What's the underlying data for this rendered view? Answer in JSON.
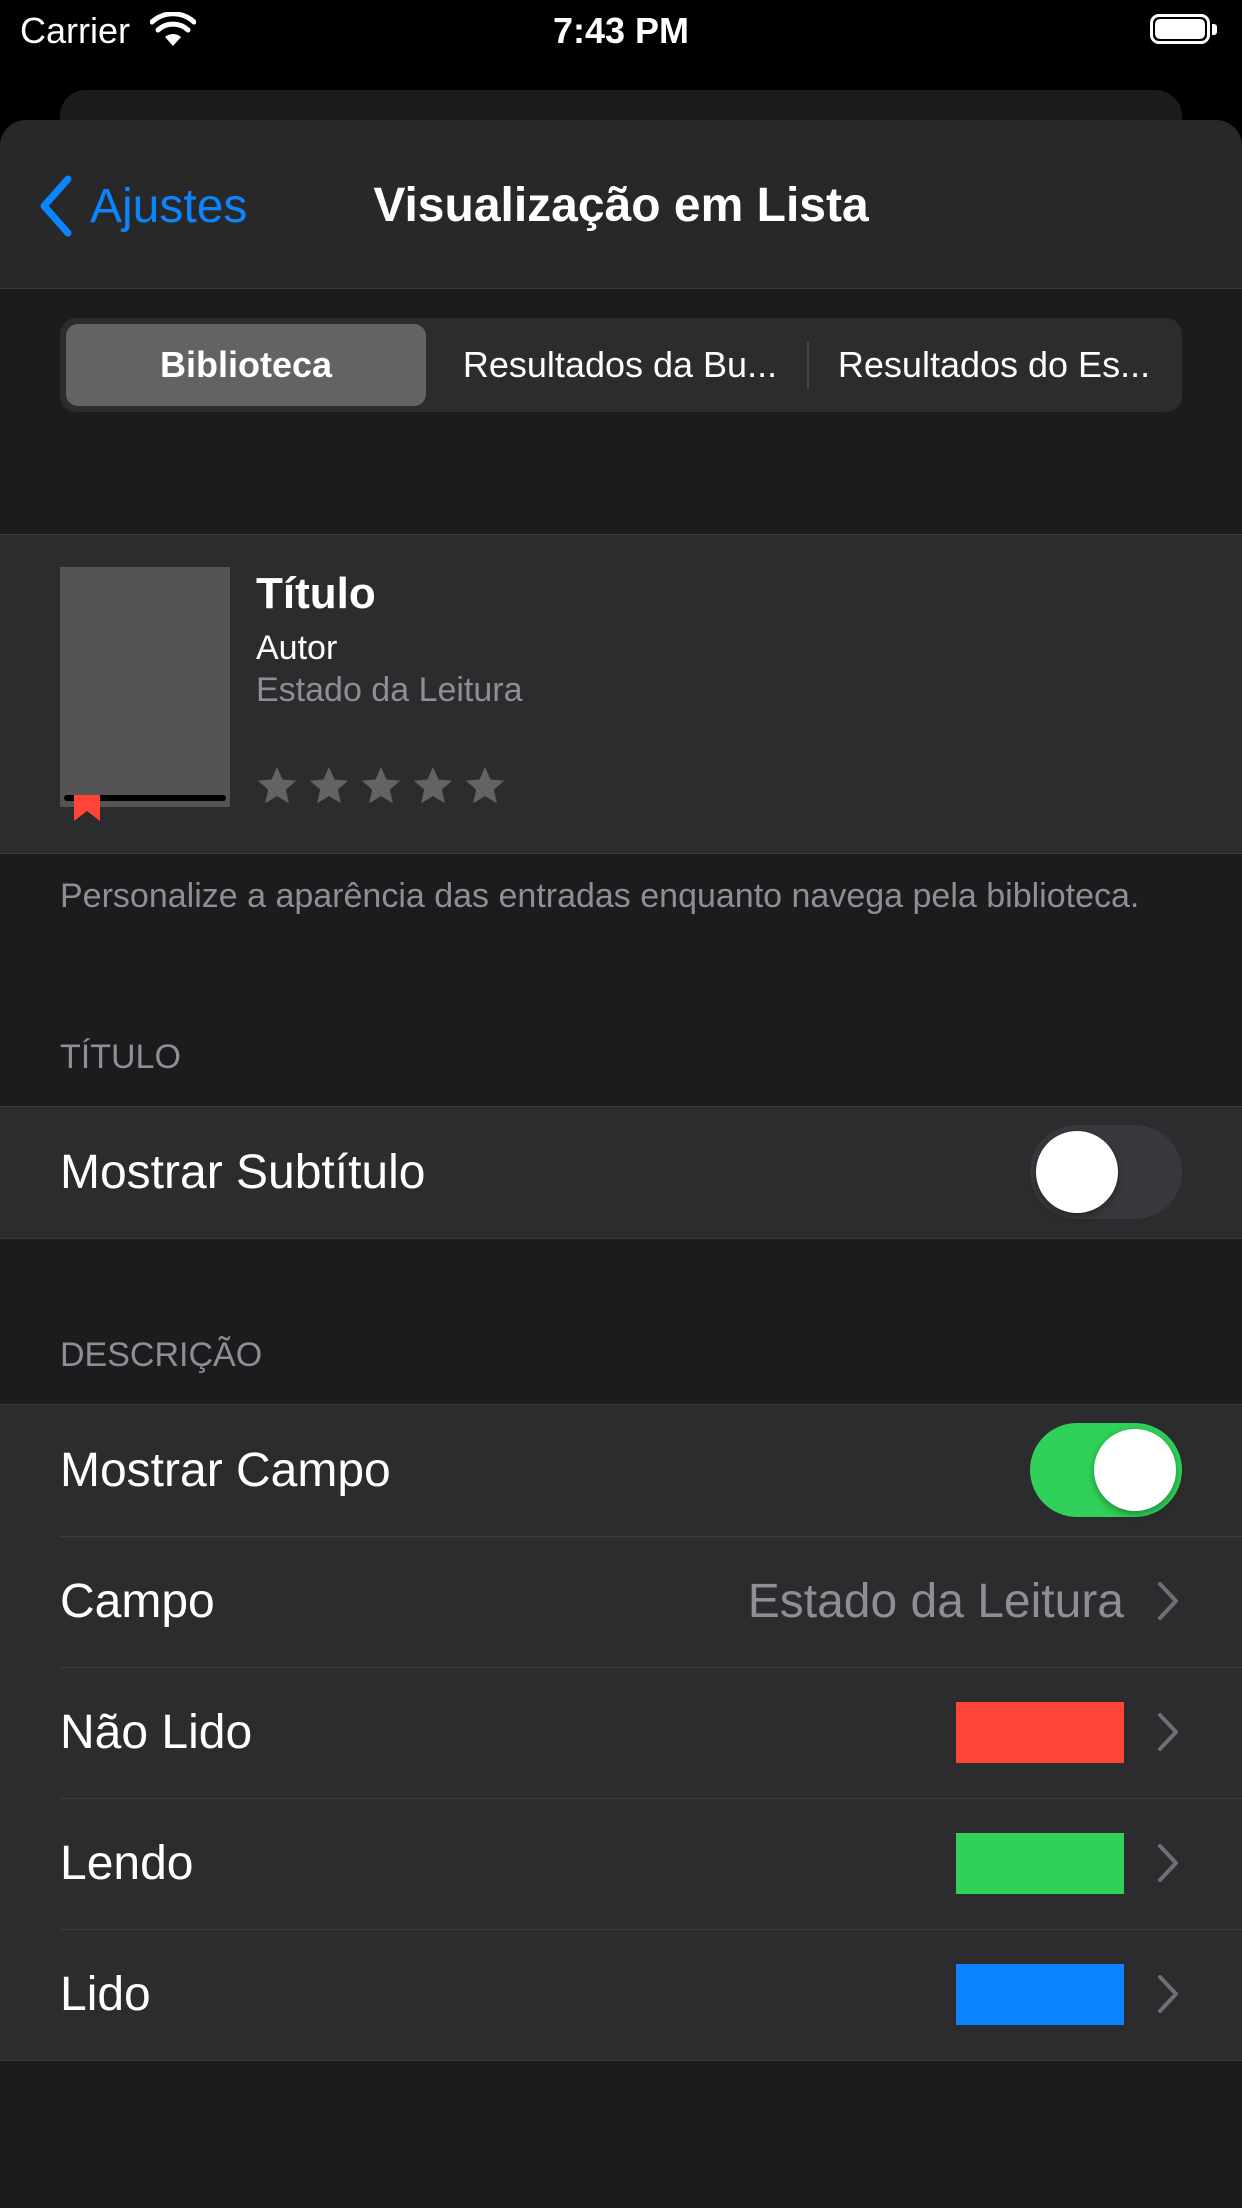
{
  "status_bar": {
    "carrier": "Carrier",
    "time": "7:43 PM"
  },
  "nav": {
    "back_label": "Ajustes",
    "title": "Visualização em Lista"
  },
  "segments": [
    {
      "label": "Biblioteca",
      "selected": true
    },
    {
      "label": "Resultados da Bu...",
      "selected": false
    },
    {
      "label": "Resultados do Es...",
      "selected": false
    }
  ],
  "preview": {
    "title": "Título",
    "author": "Autor",
    "reading_state": "Estado da Leitura",
    "rating_stars": 5,
    "star_color": "#636366",
    "bookmark_color": "#ff453a"
  },
  "footnote": "Personalize a aparência das entradas enquanto navega pela biblioteca.",
  "section_title": {
    "header": "TÍTULO",
    "rows": [
      {
        "label": "Mostrar Subtítulo",
        "toggle": false
      }
    ]
  },
  "section_description": {
    "header": "DESCRIÇÃO",
    "show_field": {
      "label": "Mostrar Campo",
      "toggle": true
    },
    "field": {
      "label": "Campo",
      "value": "Estado da Leitura"
    },
    "colors": [
      {
        "label": "Não Lido",
        "color": "#ff453a"
      },
      {
        "label": "Lendo",
        "color": "#30d158"
      },
      {
        "label": "Lido",
        "color": "#0a84ff"
      }
    ]
  },
  "accent_color": "#0a84ff"
}
